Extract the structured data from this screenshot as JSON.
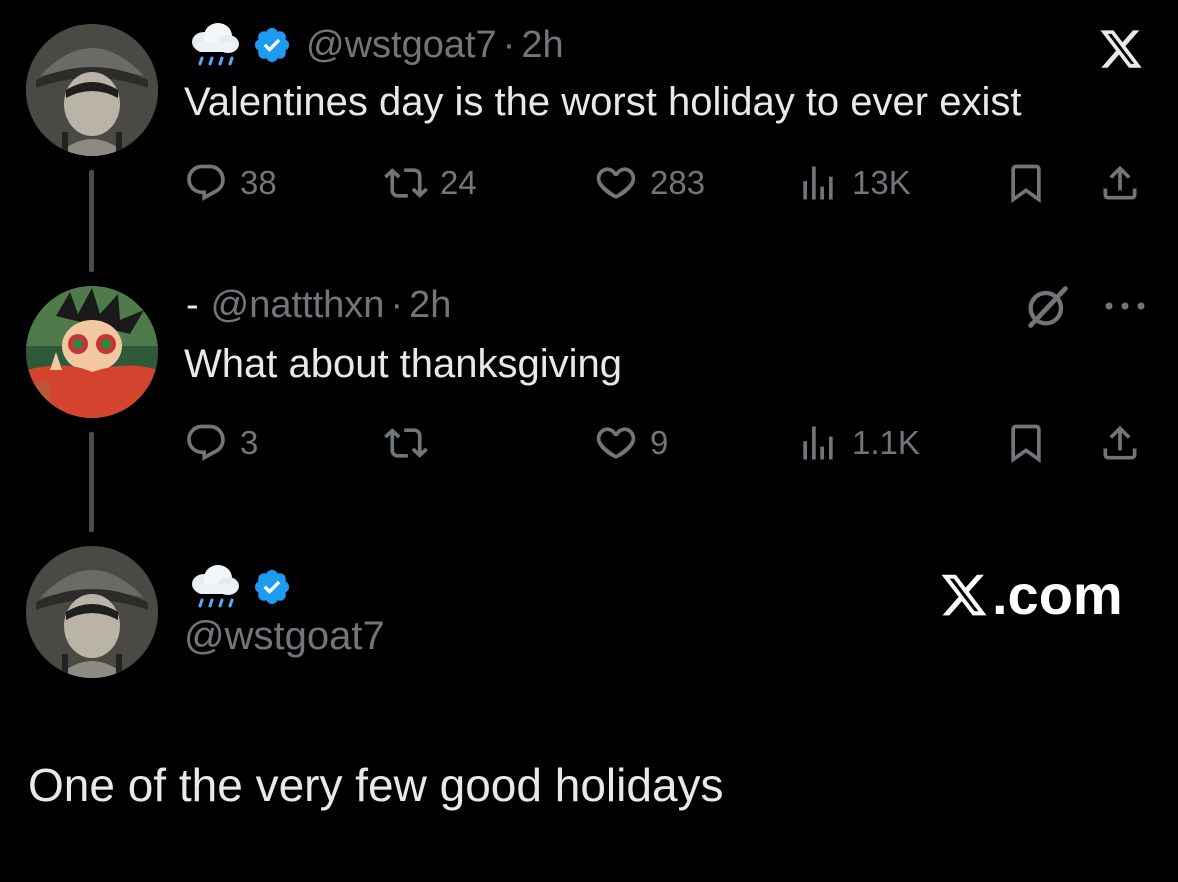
{
  "tweet1": {
    "handle": "@wstgoat7",
    "sep": "·",
    "time": "2h",
    "text": "Valentines day is the worst holiday to ever exist",
    "replies": "38",
    "retweets": "24",
    "likes": "283",
    "views": "13K"
  },
  "tweet2": {
    "name": "-",
    "handle": "@nattthxn",
    "sep": "·",
    "time": "2h",
    "text": "What about thanksgiving",
    "replies": "3",
    "retweets": "",
    "likes": "9",
    "views": "1.1K"
  },
  "tweet3": {
    "handle": "@wstgoat7",
    "brand": ".com",
    "text": "One of the very few good holidays"
  },
  "icons": {
    "verified_color": "#1d9bf0",
    "brand_icon": "x-logo-icon",
    "name_emoji": "rain-cloud-icon"
  }
}
